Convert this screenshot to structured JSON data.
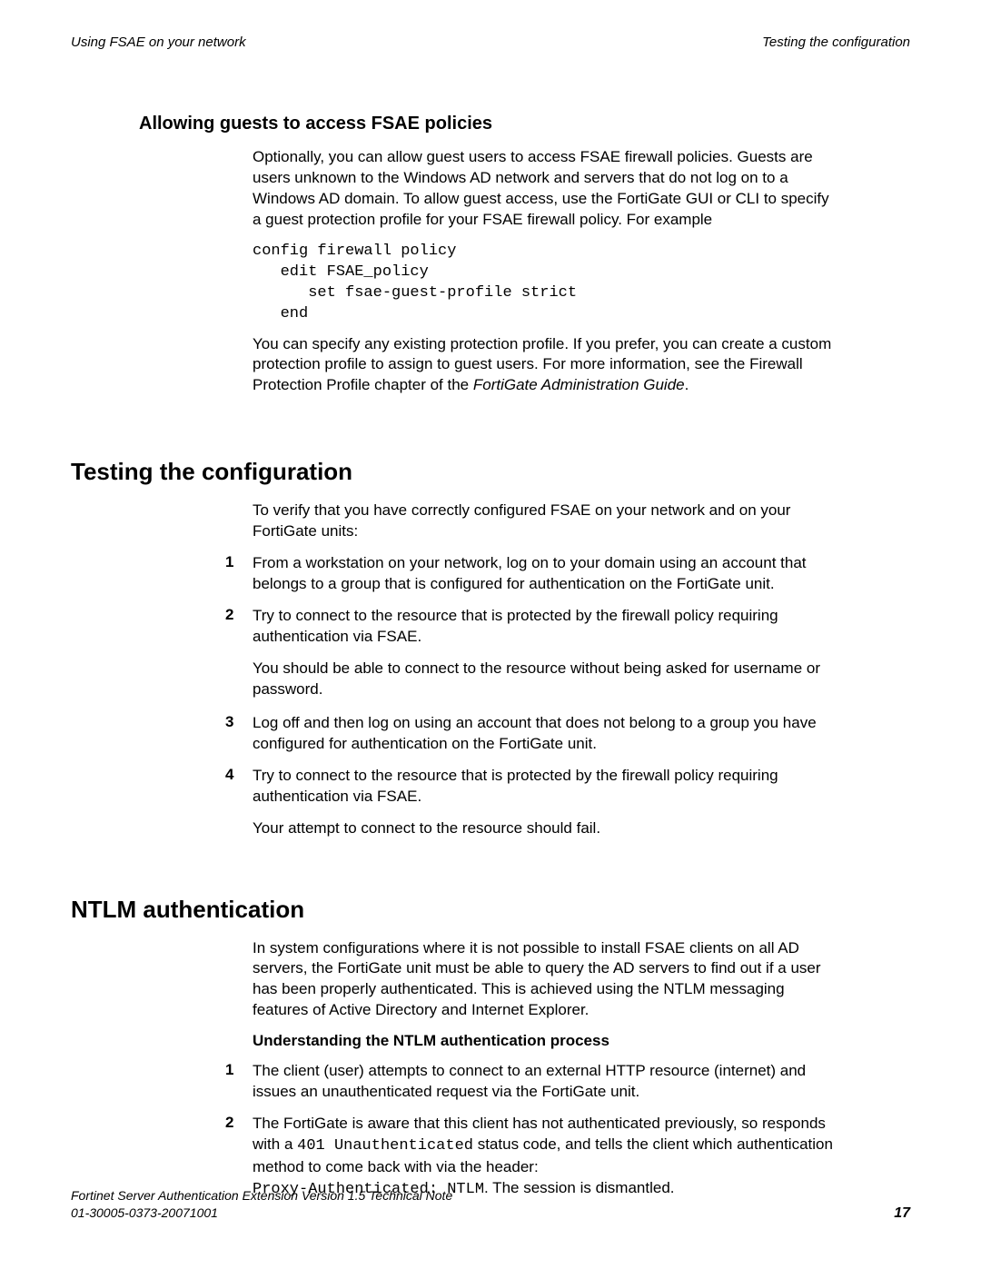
{
  "header": {
    "left": "Using FSAE on your network",
    "right": "Testing the configuration"
  },
  "sec1": {
    "title": "Allowing guests to access FSAE policies",
    "p1": "Optionally, you can allow guest users to access FSAE firewall policies. Guests are users unknown to the Windows AD network and servers that do not log on to a Windows AD domain. To allow guest access, use the FortiGate GUI or CLI to specify a guest protection profile for your FSAE firewall policy. For example",
    "code": "config firewall policy\n   edit FSAE_policy\n      set fsae-guest-profile strict\n   end",
    "p2a": "You can specify any existing protection profile. If you prefer, you can create a custom protection profile to assign to guest users. For more information, see the Firewall Protection Profile chapter of the ",
    "p2b": "FortiGate Administration Guide",
    "p2c": "."
  },
  "sec2": {
    "title": "Testing the configuration",
    "intro": "To verify that you have correctly configured FSAE on your network and on your FortiGate units:",
    "steps": [
      "From a workstation on your network, log on to your domain using an account that belongs to a group that is configured for authentication on the FortiGate unit.",
      "Try to connect to the resource that is protected by the firewall policy requiring authentication via FSAE.",
      "Log off and then log on using an account that does not belong to a group you have configured for authentication on the FortiGate unit.",
      "Try to connect to the resource that is protected by the firewall policy requiring authentication via FSAE."
    ],
    "note2": "You should be able to connect to the resource without being asked for username or password.",
    "note4": "Your attempt to connect to the resource should fail."
  },
  "sec3": {
    "title": "NTLM authentication",
    "intro": "In system configurations where it is not possible to install FSAE clients on all AD servers, the FortiGate unit must be able to query the AD servers to find out if a user has been properly authenticated. This is achieved using the NTLM messaging features of Active Directory and Internet Explorer.",
    "subhead": "Understanding the NTLM authentication process",
    "step1": "The client (user) attempts to connect to an external HTTP resource (internet) and issues an unauthenticated request via the FortiGate unit.",
    "step2a": "The FortiGate is aware that this client has not authenticated previously, so responds with a ",
    "step2code1": "401 Unauthenticated",
    "step2b": " status code, and tells the client which authentication method to come back with via the header:",
    "step2code2": "Proxy-Authenticated: NTLM",
    "step2c": ". The session is dismantled."
  },
  "footer": {
    "line1": "Fortinet Server Authentication Extension Version 1.5 Technical Note",
    "line2": "01-30005-0373-20071001",
    "page": "17"
  }
}
